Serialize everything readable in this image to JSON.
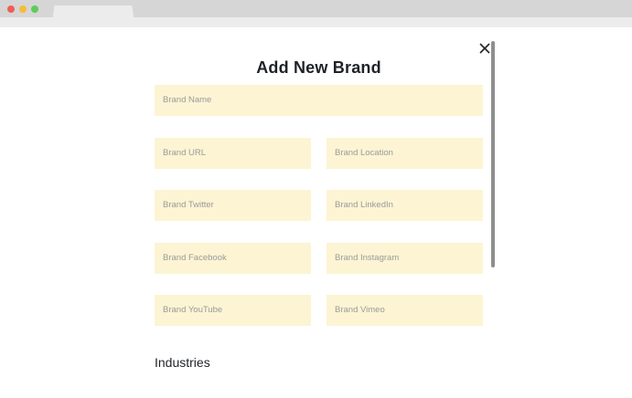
{
  "dialog": {
    "title": "Add New Brand",
    "close_icon": "close-icon"
  },
  "fields": {
    "brand_name": "Brand Name",
    "brand_url": "Brand URL",
    "brand_location": "Brand Location",
    "brand_twitter": "Brand Twitter",
    "brand_linkedin": "Brand LinkedIn",
    "brand_facebook": "Brand Facebook",
    "brand_instagram": "Brand Instagram",
    "brand_youtube": "Brand YouTube",
    "brand_vimeo": "Brand Vimeo"
  },
  "sections": {
    "industries": "Industries"
  },
  "colors": {
    "field_background": "#fdf4d3",
    "placeholder_text": "#9a9a9a",
    "heading_text": "#1f2226"
  }
}
